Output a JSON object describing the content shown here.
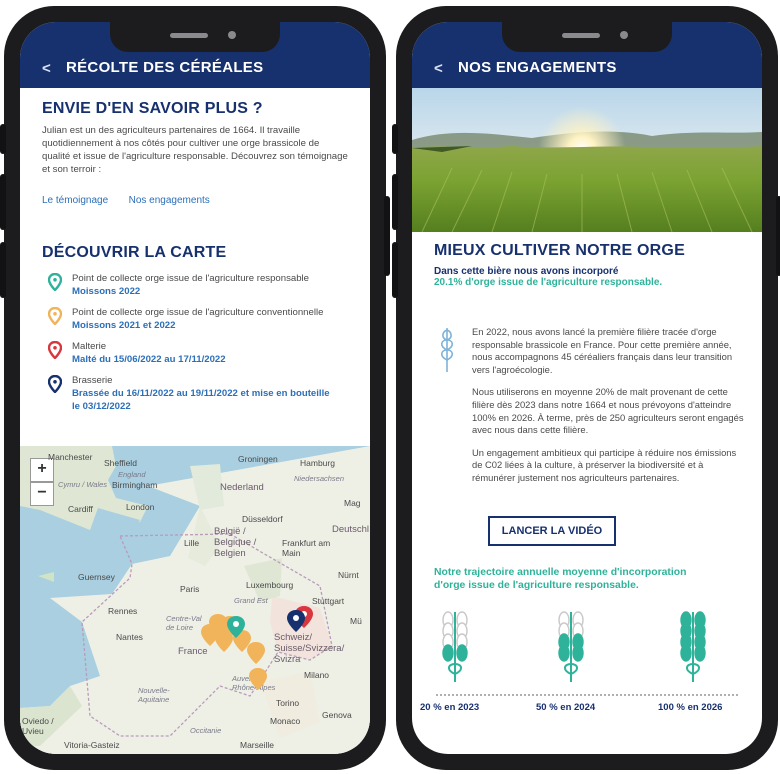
{
  "left": {
    "header_title": "RÉCOLTE DES CÉRÉALES",
    "back_icon": "chevron-left-icon",
    "learn_more_title": "ENVIE D'EN SAVOIR PLUS ?",
    "learn_more_text": "Julian est un des agriculteurs partenaires de 1664. Il travaille quotidiennement à nos côtés pour cultiver une orge brassicole de qualité et issue de l'agriculture responsable. Découvrez son témoignage et son terroir :",
    "links": [
      "Le témoignage",
      "Nos engagements"
    ],
    "map_title": "DÉCOUVRIR LA CARTE",
    "legend": [
      {
        "label": "Point de collecte orge issue de l'agriculture responsable",
        "date": "Moissons 2022",
        "color": "#2eb39a"
      },
      {
        "label": "Point de collecte orge issue de l'agriculture conventionnelle",
        "date": "Moissons 2021 et 2022",
        "color": "#f2b45a"
      },
      {
        "label": "Malterie",
        "date": "Malté du 15/06/2022 au 17/11/2022",
        "color": "#d9363e"
      },
      {
        "label": "Brasserie",
        "date": "Brassée du 16/11/2022 au 19/11/2022 et mise en bouteille le 03/12/2022",
        "color": "#17306e"
      }
    ],
    "zoom_in": "+",
    "zoom_out": "−",
    "map_labels": {
      "manchester": "Manchester",
      "sheffield": "Sheffield",
      "england": "England",
      "birmingham": "Birmingham",
      "cymru": "Cymru / Wales",
      "cardiff": "Cardiff",
      "london": "London",
      "groningen": "Groningen",
      "hamburg": "Hamburg",
      "niedersachsen": "Niedersachsen",
      "nederland": "Nederland",
      "dusseldorf": "Düsseldorf",
      "belgie": "België / Belgique / Belgien",
      "lille": "Lille",
      "frankfurt": "Frankfurt am Main",
      "deutschl": "Deutschl",
      "mag": "Mag",
      "luxembourg": "Luxembourg",
      "guernsey": "Guernsey",
      "paris": "Paris",
      "nurnt": "Nürnt",
      "grandest": "Grand Est",
      "stuttgart": "Stuttgart",
      "rennes": "Rennes",
      "centre": "Centre-Val de Loire",
      "nantes": "Nantes",
      "france": "France",
      "mu": "Mü",
      "schweiz": "Schweiz/ Suisse/Svizzera/ Svizra",
      "nouvelle": "Nouvelle-Aquitaine",
      "auvergne": "Auvergne-Rhône-Alpes",
      "milano": "Milano",
      "torino": "Torino",
      "genova": "Genova",
      "monaco": "Monaco",
      "occitanie": "Occitanie",
      "oviedo": "Oviedo / Uvieu",
      "vitoria": "Vitoria-Gasteiz",
      "marseille": "Marseille"
    }
  },
  "right": {
    "header_title": "NOS ENGAGEMENTS",
    "back_icon": "chevron-left-icon",
    "section_title": "MIEUX CULTIVER NOTRE ORGE",
    "intro_line1": "Dans cette bière nous avons incorporé",
    "intro_line2": "20.1% d'orge issue de l'agriculture responsable.",
    "paragraphs": [
      "En 2022, nous avons lancé la première filière tracée d'orge responsable brassicole en France. Pour cette première année, nous accompagnons 45 céréaliers français dans leur transition vers l'agroécologie.",
      "Nous utiliserons en moyenne 20% de malt provenant de cette filière dès 2023 dans notre 1664 et nous prévoyons d'atteindre 100% en 2026. À terme, près de 250 agriculteurs seront engagés avec nous dans cette filière.",
      "Un engagement ambitieux qui participe à réduire nos émissions de C02 liées à la culture, à préserver la biodiversité et à rémunérer justement nos agriculteurs partenaires."
    ],
    "video_button": "LANCER LA VIDÉO",
    "trajectory_line1": "Notre trajectoire annuelle moyenne d'incorporation",
    "trajectory_line2": "d'orge issue de l'agriculture responsable.",
    "milestones": [
      {
        "label": "20 % en 2023",
        "fill": 0.2
      },
      {
        "label": "50 % en 2024",
        "fill": 0.5
      },
      {
        "label": "100 % en 2026",
        "fill": 1.0
      }
    ]
  },
  "colors": {
    "brand_navy": "#17306e",
    "accent_teal": "#2eb39a",
    "link_blue": "#2c6fb8"
  }
}
